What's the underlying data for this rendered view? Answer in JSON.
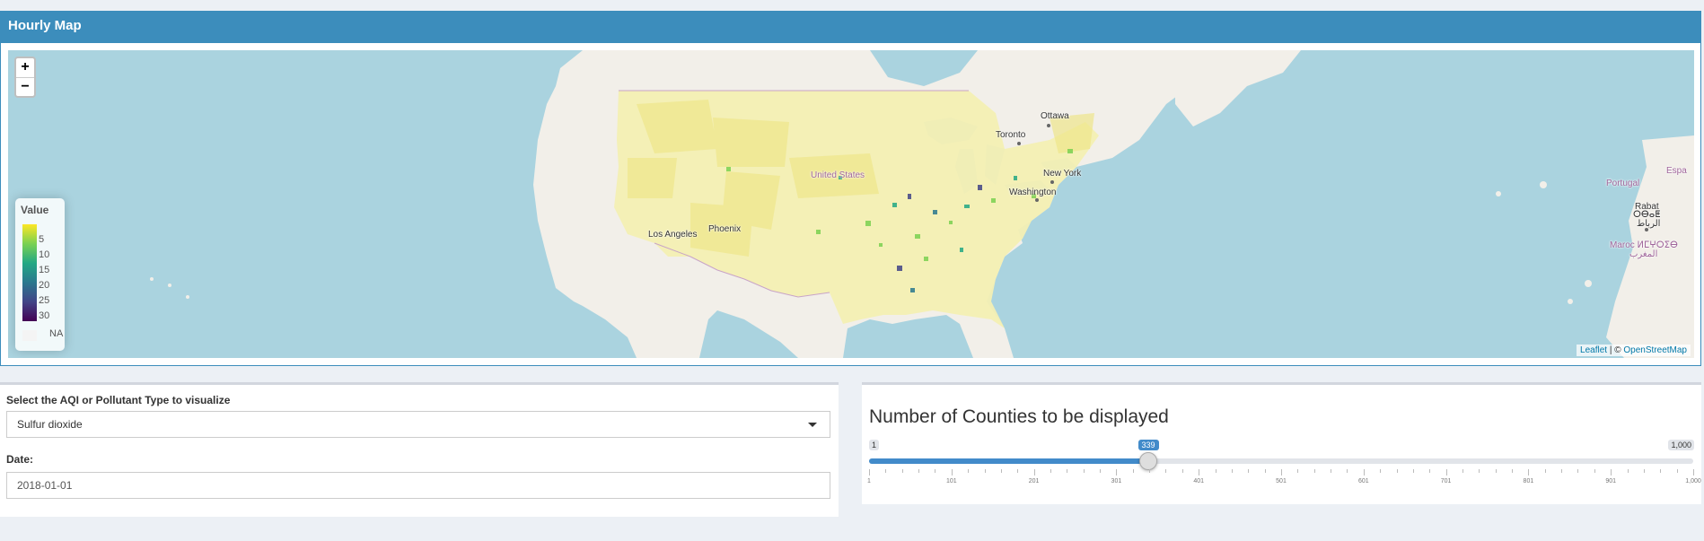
{
  "map_box": {
    "title": "Hourly Map",
    "zoom_in": "+",
    "zoom_out": "−",
    "legend": {
      "title": "Value",
      "ticks": [
        "5",
        "10",
        "15",
        "20",
        "25",
        "30"
      ],
      "na_label": "NA",
      "colors": [
        "#fde725",
        "#7ad151",
        "#22a884",
        "#2a788e",
        "#414487",
        "#440154"
      ]
    },
    "attribution": {
      "leaflet": "Leaflet",
      "sep": " | © ",
      "osm": "OpenStreetMap"
    },
    "labels": {
      "ottawa": "Ottawa",
      "toronto": "Toronto",
      "new_york": "New York",
      "washington": "Washington",
      "united_states": "United States",
      "phoenix": "Phoenix",
      "los_angeles": "Los Angeles",
      "portugal": "Portugal",
      "espana": "Espa",
      "rabat": "Rabat",
      "rabat_tf": "ⵔⴱⴰⵟ",
      "rabat_ar": "الرباط",
      "maroc": "Maroc ⵍⵎⵖⵔⵉⴱ",
      "maroc_ar": "المغرب"
    }
  },
  "form": {
    "select_label": "Select the AQI or Pollutant Type to visualize",
    "select_value": "Sulfur dioxide",
    "date_label": "Date:",
    "date_value": "2018-01-01"
  },
  "slider": {
    "title": "Number of Counties to be displayed",
    "min": "1",
    "max": "1,000",
    "value": "339",
    "value_fraction": 0.3383,
    "grid_labels": [
      "1",
      "101",
      "201",
      "301",
      "401",
      "501",
      "601",
      "701",
      "801",
      "901",
      "1,000"
    ]
  }
}
